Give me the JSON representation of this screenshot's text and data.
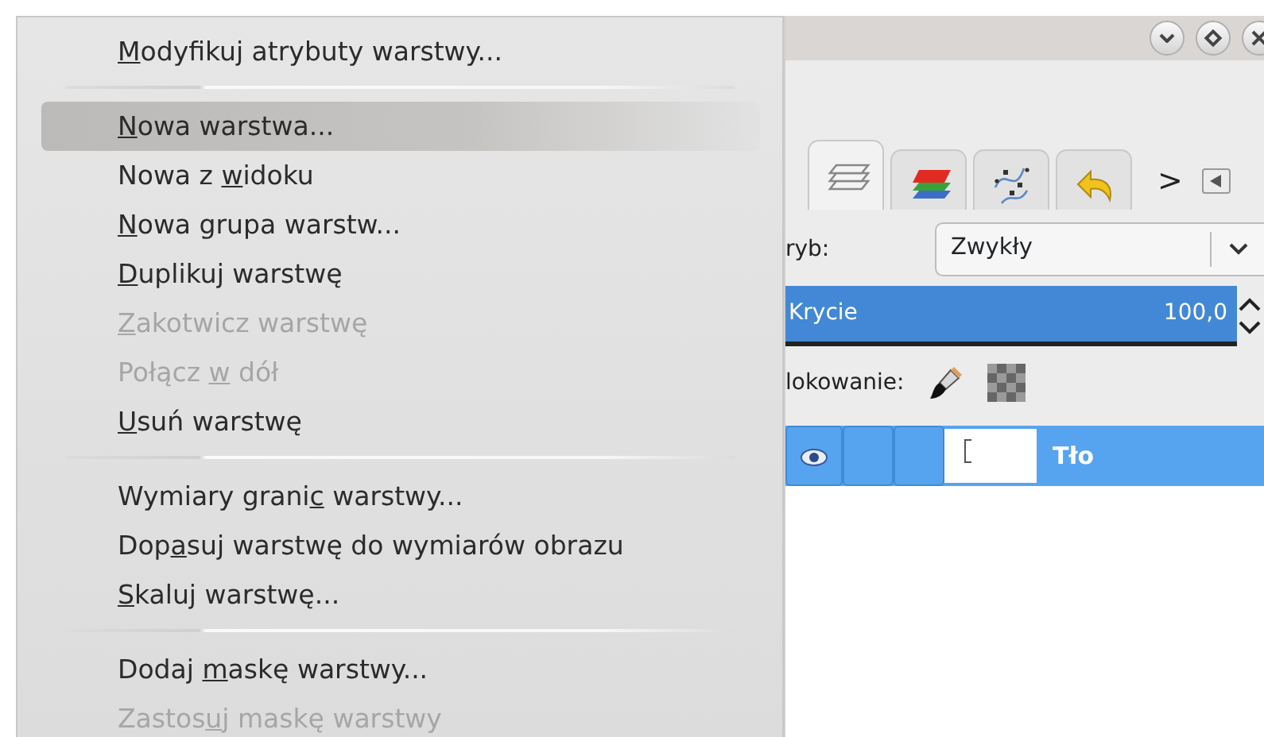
{
  "menu": {
    "items": [
      {
        "kind": "item",
        "key": "M",
        "post": "odyfikuj atrybuty warstwy...",
        "selected": false,
        "disabled": false
      },
      {
        "kind": "separator"
      },
      {
        "kind": "item",
        "key": "N",
        "post": "owa warstwa...",
        "selected": true,
        "disabled": false
      },
      {
        "kind": "item",
        "pre": "Nowa z ",
        "key": "w",
        "post": "idoku",
        "selected": false,
        "disabled": false
      },
      {
        "kind": "item",
        "key": "N",
        "post": "owa grupa warstw...",
        "selected": false,
        "disabled": false
      },
      {
        "kind": "item",
        "key": "D",
        "post": "uplikuj warstwę",
        "selected": false,
        "disabled": false
      },
      {
        "kind": "item",
        "key": "Z",
        "post": "akotwicz warstwę",
        "selected": false,
        "disabled": true
      },
      {
        "kind": "item",
        "pre": "Połącz ",
        "key": "w",
        "post": " dół",
        "selected": false,
        "disabled": true
      },
      {
        "kind": "item",
        "key": "U",
        "post": "suń warstwę",
        "selected": false,
        "disabled": false
      },
      {
        "kind": "separator"
      },
      {
        "kind": "item",
        "pre": "Wymiary grani",
        "key": "c",
        "post": " warstwy...",
        "selected": false,
        "disabled": false
      },
      {
        "kind": "item",
        "pre": "Dop",
        "key": "a",
        "post": "suj warstwę do wymiarów obrazu",
        "selected": false,
        "disabled": false
      },
      {
        "kind": "item",
        "key": "S",
        "post": "kaluj warstwę...",
        "selected": false,
        "disabled": false
      },
      {
        "kind": "separator"
      },
      {
        "kind": "item",
        "pre": "Dodaj ",
        "key": "m",
        "post": "askę warstwy...",
        "selected": false,
        "disabled": false
      },
      {
        "kind": "item",
        "pre": "Zastos",
        "key": "u",
        "post": "j maskę warstwy",
        "selected": false,
        "disabled": true
      }
    ]
  },
  "panel": {
    "tabs": [
      {
        "kind": "layers",
        "selected": true
      },
      {
        "kind": "channels",
        "selected": false
      },
      {
        "kind": "paths",
        "selected": false
      },
      {
        "kind": "undo",
        "selected": false
      }
    ],
    "tabs_more": ">",
    "mode": {
      "label": "ryb:",
      "value": "Zwykły"
    },
    "opacity": {
      "label": "Krycie",
      "reading": "100,0",
      "level": 1.0
    },
    "lock": {
      "label": "lokowanie:"
    },
    "layers": [
      {
        "name": "Tło",
        "visible": true,
        "selected": true
      }
    ]
  }
}
